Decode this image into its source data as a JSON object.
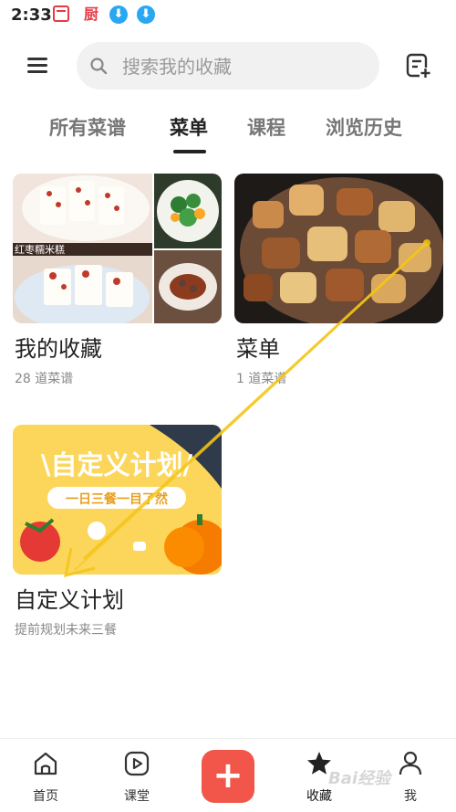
{
  "status_bar": {
    "time": "2:33",
    "chef_glyph": "厨",
    "download_glyph": "⬇"
  },
  "search": {
    "placeholder": "搜索我的收藏"
  },
  "tabs": [
    {
      "label": "所有菜谱",
      "active": false
    },
    {
      "label": "菜单",
      "active": true
    },
    {
      "label": "课程",
      "active": false
    },
    {
      "label": "浏览历史",
      "active": false
    }
  ],
  "collections": [
    {
      "title": "我的收藏",
      "subtitle": "28 道菜谱",
      "image_caption": "红枣糯米糕"
    },
    {
      "title": "菜单",
      "subtitle": "1 道菜谱"
    },
    {
      "title": "自定义计划",
      "subtitle": "提前规划未来三餐",
      "banner_title": "\\自定义计划/",
      "banner_tagline": "一日三餐一目了然"
    }
  ],
  "bottom_nav": {
    "home": "首页",
    "class": "课堂",
    "add": "+",
    "favorites": "收藏",
    "me": "我"
  },
  "watermark": "Bai经验",
  "colors": {
    "accent": "#f2564a",
    "download_blue": "#2aa7f2",
    "annotation": "#f5c518"
  }
}
